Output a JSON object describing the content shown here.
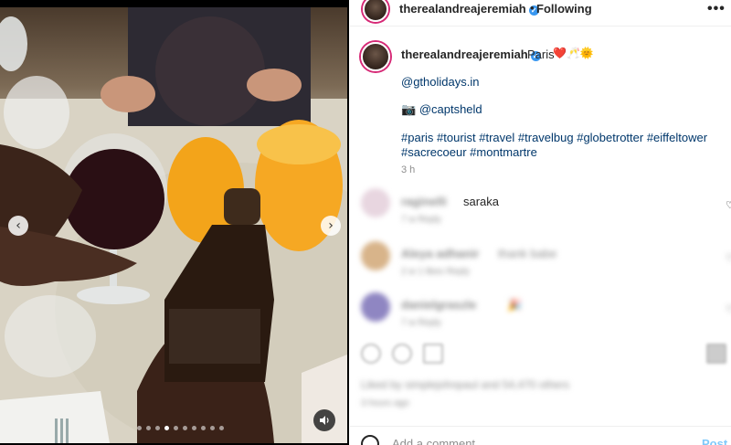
{
  "header": {
    "username": "therealandreajeremiah",
    "separator": "•",
    "follow_status": "Following",
    "more": "•••"
  },
  "caption": {
    "username": "therealandreajeremiah",
    "location": "Paris",
    "emojis": "❤️🥂🌞",
    "mention": "@gtholidays.in",
    "camera": "📷",
    "credit": "@captsheld",
    "hashtags_line1": "#paris #tourist #travel #travelbug #globetrotter #eiffeltower",
    "hashtags_line2": "#sacrecoeur #montmartre",
    "time": "3 h"
  },
  "comments": [
    {
      "username": "raginelli",
      "text": "saraka",
      "meta": "7 w   Reply"
    },
    {
      "username": "Aleya adhanir",
      "text": "thank babe",
      "meta": "2 w   1 likes   Reply"
    },
    {
      "username": "danielgraszle",
      "text": "🎉",
      "meta": "7 w   Reply"
    }
  ],
  "likes_text": "Liked by simplejohnpaul and 54,470 others",
  "likes_time": "3 hours ago",
  "comment_placeholder": "Add a comment...",
  "post_label": "Post",
  "carousel": {
    "total": 10,
    "active_index": 3
  },
  "colors": {
    "accent": "#0095f6",
    "verified": "#3897f0",
    "story_ring": "#d62976"
  },
  "icons": [
    "chevron-left-icon",
    "chevron-right-icon",
    "volume-icon",
    "verified-icon",
    "more-icon",
    "heart-icon",
    "comment-icon",
    "share-icon",
    "bookmark-icon",
    "emoji-icon"
  ]
}
